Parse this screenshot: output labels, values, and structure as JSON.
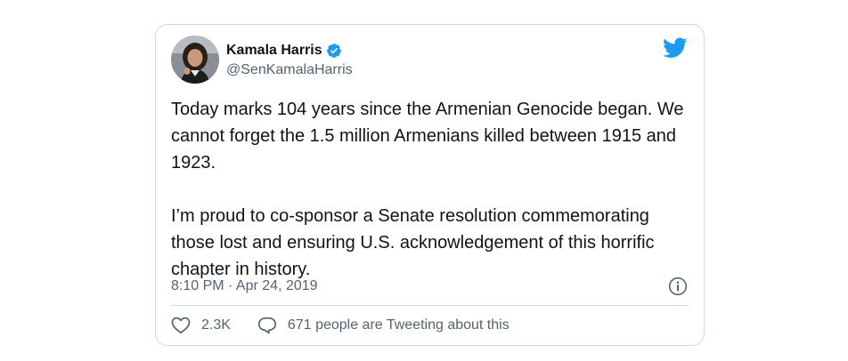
{
  "tweet": {
    "author": {
      "display_name": "Kamala Harris",
      "handle": "@SenKamalaHarris",
      "verified": true
    },
    "paragraphs": [
      "Today marks 104 years since the Armenian Genocide began. We cannot forget the 1.5 million Armenians killed between 1915 and 1923.",
      "I’m proud to co-sponsor a Senate resolution commemorating those lost and ensuring U.S. acknowledgement of this horrific chapter in history."
    ],
    "timestamp": "8:10 PM · Apr 24, 2019",
    "likes": "2.3K",
    "tweeting_about": "671 people are Tweeting about this"
  },
  "icons": {
    "brand": "twitter-bird-icon",
    "verified": "verified-badge-icon",
    "info": "info-icon",
    "like": "heart-icon",
    "reply": "speech-bubble-icon"
  },
  "colors": {
    "brand_blue": "#1d9bf0",
    "text_primary": "#0f1419",
    "text_secondary": "#536471",
    "border": "#cfd9de"
  }
}
